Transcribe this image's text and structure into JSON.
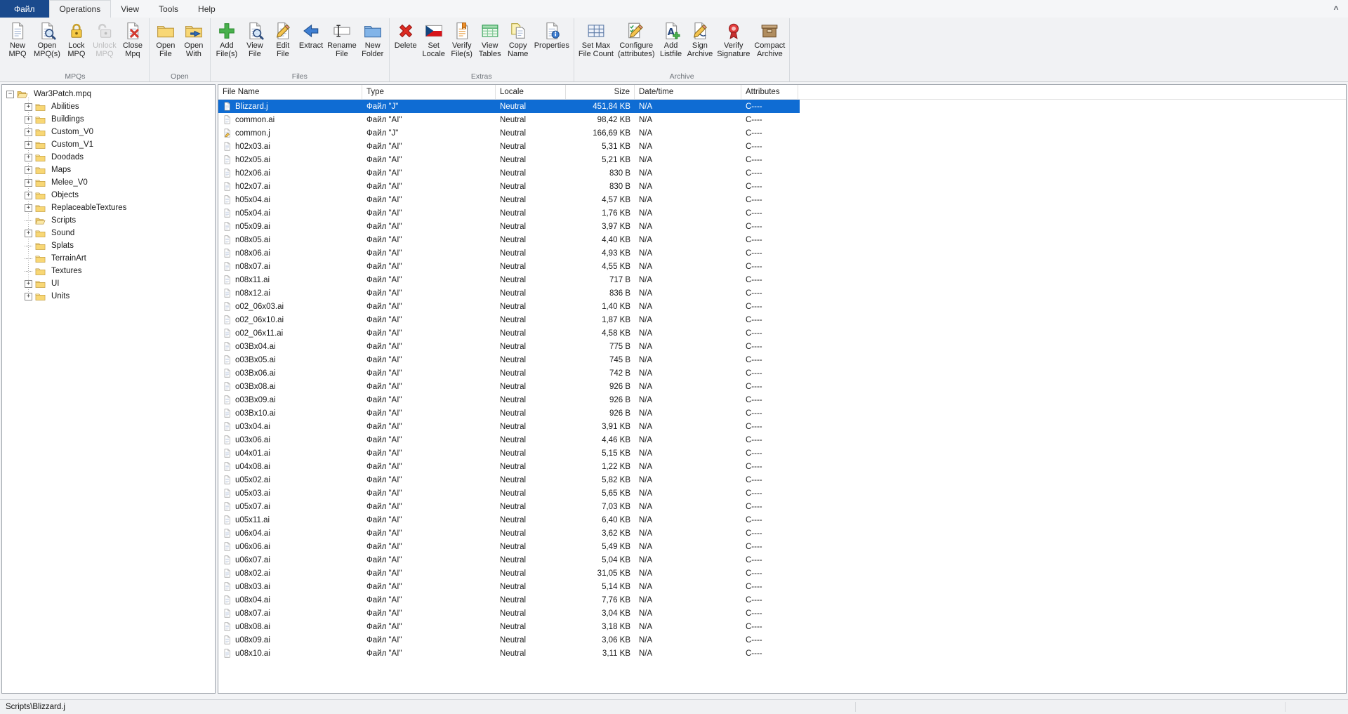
{
  "app": {
    "tabs": [
      "Файл",
      "Operations",
      "View",
      "Tools",
      "Help"
    ],
    "active_tab": "Operations",
    "collapse_glyph": "^",
    "colors": {
      "selection": "#0f6cd3",
      "file_tab": "#1a4a8d"
    }
  },
  "ribbon": {
    "groups": [
      {
        "label": "MPQs",
        "buttons": [
          {
            "lines": [
              "New",
              "MPQ"
            ],
            "icon": "new-mpq",
            "enabled": true
          },
          {
            "lines": [
              "Open",
              "MPQ(s)"
            ],
            "icon": "open-mpq",
            "enabled": true
          },
          {
            "lines": [
              "Lock",
              "MPQ"
            ],
            "icon": "lock",
            "enabled": true
          },
          {
            "lines": [
              "Unlock",
              "MPQ"
            ],
            "icon": "unlock",
            "enabled": false
          },
          {
            "lines": [
              "Close",
              "Mpq"
            ],
            "icon": "close-mpq",
            "enabled": true
          }
        ]
      },
      {
        "label": "Open",
        "buttons": [
          {
            "lines": [
              "Open",
              "File"
            ],
            "icon": "open-file",
            "enabled": true
          },
          {
            "lines": [
              "Open",
              "With"
            ],
            "icon": "open-with",
            "enabled": true
          }
        ]
      },
      {
        "label": "Files",
        "buttons": [
          {
            "lines": [
              "Add",
              "File(s)"
            ],
            "icon": "add-files",
            "enabled": true
          },
          {
            "lines": [
              "View",
              "File"
            ],
            "icon": "view-file",
            "enabled": true
          },
          {
            "lines": [
              "Edit",
              "File"
            ],
            "icon": "edit-file",
            "enabled": true
          },
          {
            "lines": [
              "Extract"
            ],
            "icon": "extract",
            "enabled": true
          },
          {
            "lines": [
              "Rename",
              "File"
            ],
            "icon": "rename-file",
            "enabled": true
          },
          {
            "lines": [
              "New",
              "Folder"
            ],
            "icon": "new-folder",
            "enabled": true
          }
        ]
      },
      {
        "label": "Extras",
        "buttons": [
          {
            "lines": [
              "Delete"
            ],
            "icon": "delete",
            "enabled": true
          },
          {
            "lines": [
              "Set",
              "Locale"
            ],
            "icon": "set-locale",
            "enabled": true
          },
          {
            "lines": [
              "Verify",
              "File(s)"
            ],
            "icon": "verify-files",
            "enabled": true
          },
          {
            "lines": [
              "View",
              "Tables"
            ],
            "icon": "view-tables",
            "enabled": true
          },
          {
            "lines": [
              "Copy",
              "Name"
            ],
            "icon": "copy-name",
            "enabled": true
          },
          {
            "lines": [
              "Properties"
            ],
            "icon": "properties",
            "enabled": true
          }
        ]
      },
      {
        "label": "Archive",
        "buttons": [
          {
            "lines": [
              "Set Max",
              "File Count"
            ],
            "icon": "set-max",
            "enabled": true
          },
          {
            "lines": [
              "Configure",
              "(attributes)"
            ],
            "icon": "configure",
            "enabled": true
          },
          {
            "lines": [
              "Add",
              "Listfile"
            ],
            "icon": "add-listfile",
            "enabled": true
          },
          {
            "lines": [
              "Sign",
              "Archive"
            ],
            "icon": "sign-archive",
            "enabled": true
          },
          {
            "lines": [
              "Verify",
              "Signature"
            ],
            "icon": "verify-signature",
            "enabled": true
          },
          {
            "lines": [
              "Compact",
              "Archive"
            ],
            "icon": "compact-archive",
            "enabled": true
          }
        ]
      }
    ]
  },
  "tree": {
    "root": {
      "label": "War3Patch.mpq",
      "expanded": true,
      "icon": "folder-open"
    },
    "items": [
      {
        "label": "Abilities",
        "expandable": true
      },
      {
        "label": "Buildings",
        "expandable": true
      },
      {
        "label": "Custom_V0",
        "expandable": true
      },
      {
        "label": "Custom_V1",
        "expandable": true
      },
      {
        "label": "Doodads",
        "expandable": true
      },
      {
        "label": "Maps",
        "expandable": true
      },
      {
        "label": "Melee_V0",
        "expandable": true
      },
      {
        "label": "Objects",
        "expandable": true
      },
      {
        "label": "ReplaceableTextures",
        "expandable": true
      },
      {
        "label": "Scripts",
        "expandable": false,
        "open": true
      },
      {
        "label": "Sound",
        "expandable": true
      },
      {
        "label": "Splats",
        "expandable": false
      },
      {
        "label": "TerrainArt",
        "expandable": false
      },
      {
        "label": "Textures",
        "expandable": false
      },
      {
        "label": "UI",
        "expandable": true
      },
      {
        "label": "Units",
        "expandable": true
      }
    ]
  },
  "filelist": {
    "columns": [
      {
        "label": "File Name"
      },
      {
        "label": "Type"
      },
      {
        "label": "Locale"
      },
      {
        "label": "Size"
      },
      {
        "label": "Date/time"
      },
      {
        "label": "Attributes"
      }
    ],
    "rows": [
      {
        "name": "Blizzard.j",
        "type": "Файл \"J\"",
        "locale": "Neutral",
        "size": "451,84 KB",
        "date": "N/A",
        "attrs": "C----",
        "selected": true
      },
      {
        "name": "common.ai",
        "type": "Файл \"AI\"",
        "locale": "Neutral",
        "size": "98,42 KB",
        "date": "N/A",
        "attrs": "C----"
      },
      {
        "name": "common.j",
        "type": "Файл \"J\"",
        "locale": "Neutral",
        "size": "166,69 KB",
        "date": "N/A",
        "attrs": "C----",
        "icon": "file-edit"
      },
      {
        "name": "h02x03.ai",
        "type": "Файл \"AI\"",
        "locale": "Neutral",
        "size": "5,31 KB",
        "date": "N/A",
        "attrs": "C----"
      },
      {
        "name": "h02x05.ai",
        "type": "Файл \"AI\"",
        "locale": "Neutral",
        "size": "5,21 KB",
        "date": "N/A",
        "attrs": "C----"
      },
      {
        "name": "h02x06.ai",
        "type": "Файл \"AI\"",
        "locale": "Neutral",
        "size": "830 B",
        "date": "N/A",
        "attrs": "C----"
      },
      {
        "name": "h02x07.ai",
        "type": "Файл \"AI\"",
        "locale": "Neutral",
        "size": "830 B",
        "date": "N/A",
        "attrs": "C----"
      },
      {
        "name": "h05x04.ai",
        "type": "Файл \"AI\"",
        "locale": "Neutral",
        "size": "4,57 KB",
        "date": "N/A",
        "attrs": "C----"
      },
      {
        "name": "n05x04.ai",
        "type": "Файл \"AI\"",
        "locale": "Neutral",
        "size": "1,76 KB",
        "date": "N/A",
        "attrs": "C----"
      },
      {
        "name": "n05x09.ai",
        "type": "Файл \"AI\"",
        "locale": "Neutral",
        "size": "3,97 KB",
        "date": "N/A",
        "attrs": "C----"
      },
      {
        "name": "n08x05.ai",
        "type": "Файл \"AI\"",
        "locale": "Neutral",
        "size": "4,40 KB",
        "date": "N/A",
        "attrs": "C----"
      },
      {
        "name": "n08x06.ai",
        "type": "Файл \"AI\"",
        "locale": "Neutral",
        "size": "4,93 KB",
        "date": "N/A",
        "attrs": "C----"
      },
      {
        "name": "n08x07.ai",
        "type": "Файл \"AI\"",
        "locale": "Neutral",
        "size": "4,55 KB",
        "date": "N/A",
        "attrs": "C----"
      },
      {
        "name": "n08x11.ai",
        "type": "Файл \"AI\"",
        "locale": "Neutral",
        "size": "717 B",
        "date": "N/A",
        "attrs": "C----"
      },
      {
        "name": "n08x12.ai",
        "type": "Файл \"AI\"",
        "locale": "Neutral",
        "size": "836 B",
        "date": "N/A",
        "attrs": "C----"
      },
      {
        "name": "o02_06x03.ai",
        "type": "Файл \"AI\"",
        "locale": "Neutral",
        "size": "1,40 KB",
        "date": "N/A",
        "attrs": "C----"
      },
      {
        "name": "o02_06x10.ai",
        "type": "Файл \"AI\"",
        "locale": "Neutral",
        "size": "1,87 KB",
        "date": "N/A",
        "attrs": "C----"
      },
      {
        "name": "o02_06x11.ai",
        "type": "Файл \"AI\"",
        "locale": "Neutral",
        "size": "4,58 KB",
        "date": "N/A",
        "attrs": "C----"
      },
      {
        "name": "o03Bx04.ai",
        "type": "Файл \"AI\"",
        "locale": "Neutral",
        "size": "775 B",
        "date": "N/A",
        "attrs": "C----"
      },
      {
        "name": "o03Bx05.ai",
        "type": "Файл \"AI\"",
        "locale": "Neutral",
        "size": "745 B",
        "date": "N/A",
        "attrs": "C----"
      },
      {
        "name": "o03Bx06.ai",
        "type": "Файл \"AI\"",
        "locale": "Neutral",
        "size": "742 B",
        "date": "N/A",
        "attrs": "C----"
      },
      {
        "name": "o03Bx08.ai",
        "type": "Файл \"AI\"",
        "locale": "Neutral",
        "size": "926 B",
        "date": "N/A",
        "attrs": "C----"
      },
      {
        "name": "o03Bx09.ai",
        "type": "Файл \"AI\"",
        "locale": "Neutral",
        "size": "926 B",
        "date": "N/A",
        "attrs": "C----"
      },
      {
        "name": "o03Bx10.ai",
        "type": "Файл \"AI\"",
        "locale": "Neutral",
        "size": "926 B",
        "date": "N/A",
        "attrs": "C----"
      },
      {
        "name": "u03x04.ai",
        "type": "Файл \"AI\"",
        "locale": "Neutral",
        "size": "3,91 KB",
        "date": "N/A",
        "attrs": "C----"
      },
      {
        "name": "u03x06.ai",
        "type": "Файл \"AI\"",
        "locale": "Neutral",
        "size": "4,46 KB",
        "date": "N/A",
        "attrs": "C----"
      },
      {
        "name": "u04x01.ai",
        "type": "Файл \"AI\"",
        "locale": "Neutral",
        "size": "5,15 KB",
        "date": "N/A",
        "attrs": "C----"
      },
      {
        "name": "u04x08.ai",
        "type": "Файл \"AI\"",
        "locale": "Neutral",
        "size": "1,22 KB",
        "date": "N/A",
        "attrs": "C----"
      },
      {
        "name": "u05x02.ai",
        "type": "Файл \"AI\"",
        "locale": "Neutral",
        "size": "5,82 KB",
        "date": "N/A",
        "attrs": "C----"
      },
      {
        "name": "u05x03.ai",
        "type": "Файл \"AI\"",
        "locale": "Neutral",
        "size": "5,65 KB",
        "date": "N/A",
        "attrs": "C----"
      },
      {
        "name": "u05x07.ai",
        "type": "Файл \"AI\"",
        "locale": "Neutral",
        "size": "7,03 KB",
        "date": "N/A",
        "attrs": "C----"
      },
      {
        "name": "u05x11.ai",
        "type": "Файл \"AI\"",
        "locale": "Neutral",
        "size": "6,40 KB",
        "date": "N/A",
        "attrs": "C----"
      },
      {
        "name": "u06x04.ai",
        "type": "Файл \"AI\"",
        "locale": "Neutral",
        "size": "3,62 KB",
        "date": "N/A",
        "attrs": "C----"
      },
      {
        "name": "u06x06.ai",
        "type": "Файл \"AI\"",
        "locale": "Neutral",
        "size": "5,49 KB",
        "date": "N/A",
        "attrs": "C----"
      },
      {
        "name": "u06x07.ai",
        "type": "Файл \"AI\"",
        "locale": "Neutral",
        "size": "5,04 KB",
        "date": "N/A",
        "attrs": "C----"
      },
      {
        "name": "u08x02.ai",
        "type": "Файл \"AI\"",
        "locale": "Neutral",
        "size": "31,05 KB",
        "date": "N/A",
        "attrs": "C----"
      },
      {
        "name": "u08x03.ai",
        "type": "Файл \"AI\"",
        "locale": "Neutral",
        "size": "5,14 KB",
        "date": "N/A",
        "attrs": "C----"
      },
      {
        "name": "u08x04.ai",
        "type": "Файл \"AI\"",
        "locale": "Neutral",
        "size": "7,76 KB",
        "date": "N/A",
        "attrs": "C----"
      },
      {
        "name": "u08x07.ai",
        "type": "Файл \"AI\"",
        "locale": "Neutral",
        "size": "3,04 KB",
        "date": "N/A",
        "attrs": "C----"
      },
      {
        "name": "u08x08.ai",
        "type": "Файл \"AI\"",
        "locale": "Neutral",
        "size": "3,18 KB",
        "date": "N/A",
        "attrs": "C----"
      },
      {
        "name": "u08x09.ai",
        "type": "Файл \"AI\"",
        "locale": "Neutral",
        "size": "3,06 KB",
        "date": "N/A",
        "attrs": "C----"
      },
      {
        "name": "u08x10.ai",
        "type": "Файл \"AI\"",
        "locale": "Neutral",
        "size": "3,11 KB",
        "date": "N/A",
        "attrs": "C----"
      }
    ]
  },
  "statusbar": {
    "text": "Scripts\\Blizzard.j"
  }
}
